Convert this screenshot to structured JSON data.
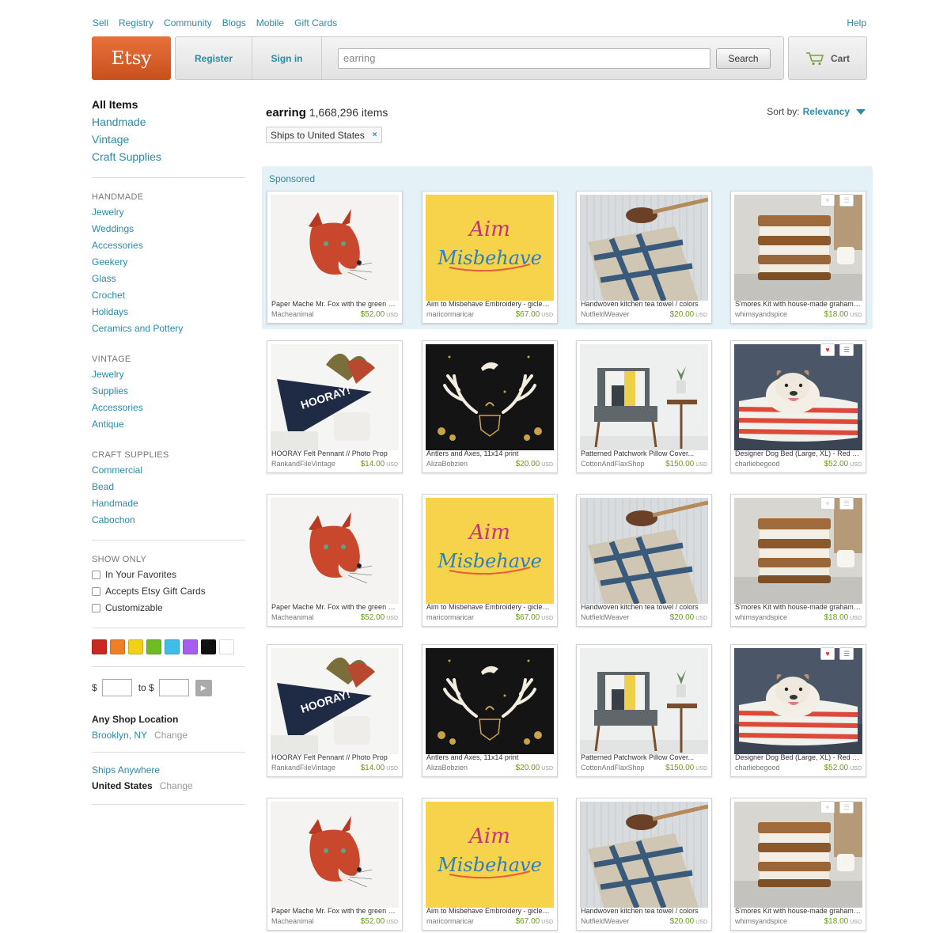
{
  "topnav": [
    "Sell",
    "Registry",
    "Community",
    "Blogs",
    "Mobile",
    "Gift Cards"
  ],
  "help": "Help",
  "logo": "Etsy",
  "header": {
    "register": "Register",
    "signin": "Sign in",
    "search_value": "earring",
    "search_button": "Search",
    "cart": "Cart"
  },
  "sidebar": {
    "categories": [
      "All Items",
      "Handmade",
      "Vintage",
      "Craft Supplies"
    ],
    "handmade": {
      "title": "HANDMADE",
      "items": [
        "Jewelry",
        "Weddings",
        "Accessories",
        "Geekery",
        "Glass",
        "Crochet",
        "Holidays",
        "Ceramics and Pottery"
      ]
    },
    "vintage": {
      "title": "VINTAGE",
      "items": [
        "Jewelry",
        "Supplies",
        "Accessories",
        "Antique"
      ]
    },
    "craft": {
      "title": "CRAFT SUPPLIES",
      "items": [
        "Commercial",
        "Bead",
        "Handmade",
        "Cabochon"
      ]
    },
    "show_only": {
      "title": "SHOW ONLY",
      "items": [
        "In Your Favorites",
        "Accepts Etsy Gift Cards",
        "Customizable"
      ]
    },
    "colors": [
      "#c8281f",
      "#ef7f26",
      "#f2d018",
      "#6dbd22",
      "#3dbde8",
      "#a55ef0",
      "#111111",
      "#ffffff"
    ],
    "price": {
      "currency": "$",
      "to": "to $"
    },
    "location": {
      "title": "Any Shop Location",
      "value": "Brooklyn, NY",
      "change": "Change"
    },
    "ships": {
      "anywhere": "Ships Anywhere",
      "value": "United States",
      "change": "Change"
    }
  },
  "results": {
    "query": "earring",
    "count": "1,668,296 items",
    "sort_label": "Sort by:",
    "sort_value": "Relevancy",
    "filter_chip": "Ships to United States",
    "filter_remove": "×",
    "sponsored": "Sponsored"
  },
  "products": [
    {
      "title": "Paper Mache Mr. Fox with the green eyes",
      "shop": "Macheanimal",
      "price": "$52.00",
      "currency": "USD",
      "image": "fox"
    },
    {
      "title": "Aim to Misbehave Embroidery - giclee print",
      "shop": "maricormaricar",
      "price": "$67.00",
      "currency": "USD",
      "image": "aim"
    },
    {
      "title": "Handwoven kitchen tea towel / colors",
      "shop": "NutfieldWeaver",
      "price": "$20.00",
      "currency": "USD",
      "image": "towel"
    },
    {
      "title": "S'mores Kit with house-made graham crackers",
      "shop": "whimsyandspice",
      "price": "$18.00",
      "currency": "USD",
      "image": "smores"
    },
    {
      "title": "HOORAY Felt Pennant // Photo Prop",
      "shop": "RankandFileVintage",
      "price": "$14.00",
      "currency": "USD",
      "image": "hooray"
    },
    {
      "title": "Antlers and Axes, 11x14 print",
      "shop": "AlizaBobzien",
      "price": "$20.00",
      "currency": "USD",
      "image": "antlers"
    },
    {
      "title": "Patterned Patchwork Pillow Cover...",
      "shop": "CottonAndFlaxShop",
      "price": "$150.00",
      "currency": "USD",
      "image": "pillow"
    },
    {
      "title": "Designer Dog Bed (Large, XL) - Red stripe",
      "shop": "charliebegood",
      "price": "$52.00",
      "currency": "USD",
      "image": "dog"
    }
  ],
  "favorite_icon": "heart-icon",
  "list_icon": "add-to-list-icon"
}
